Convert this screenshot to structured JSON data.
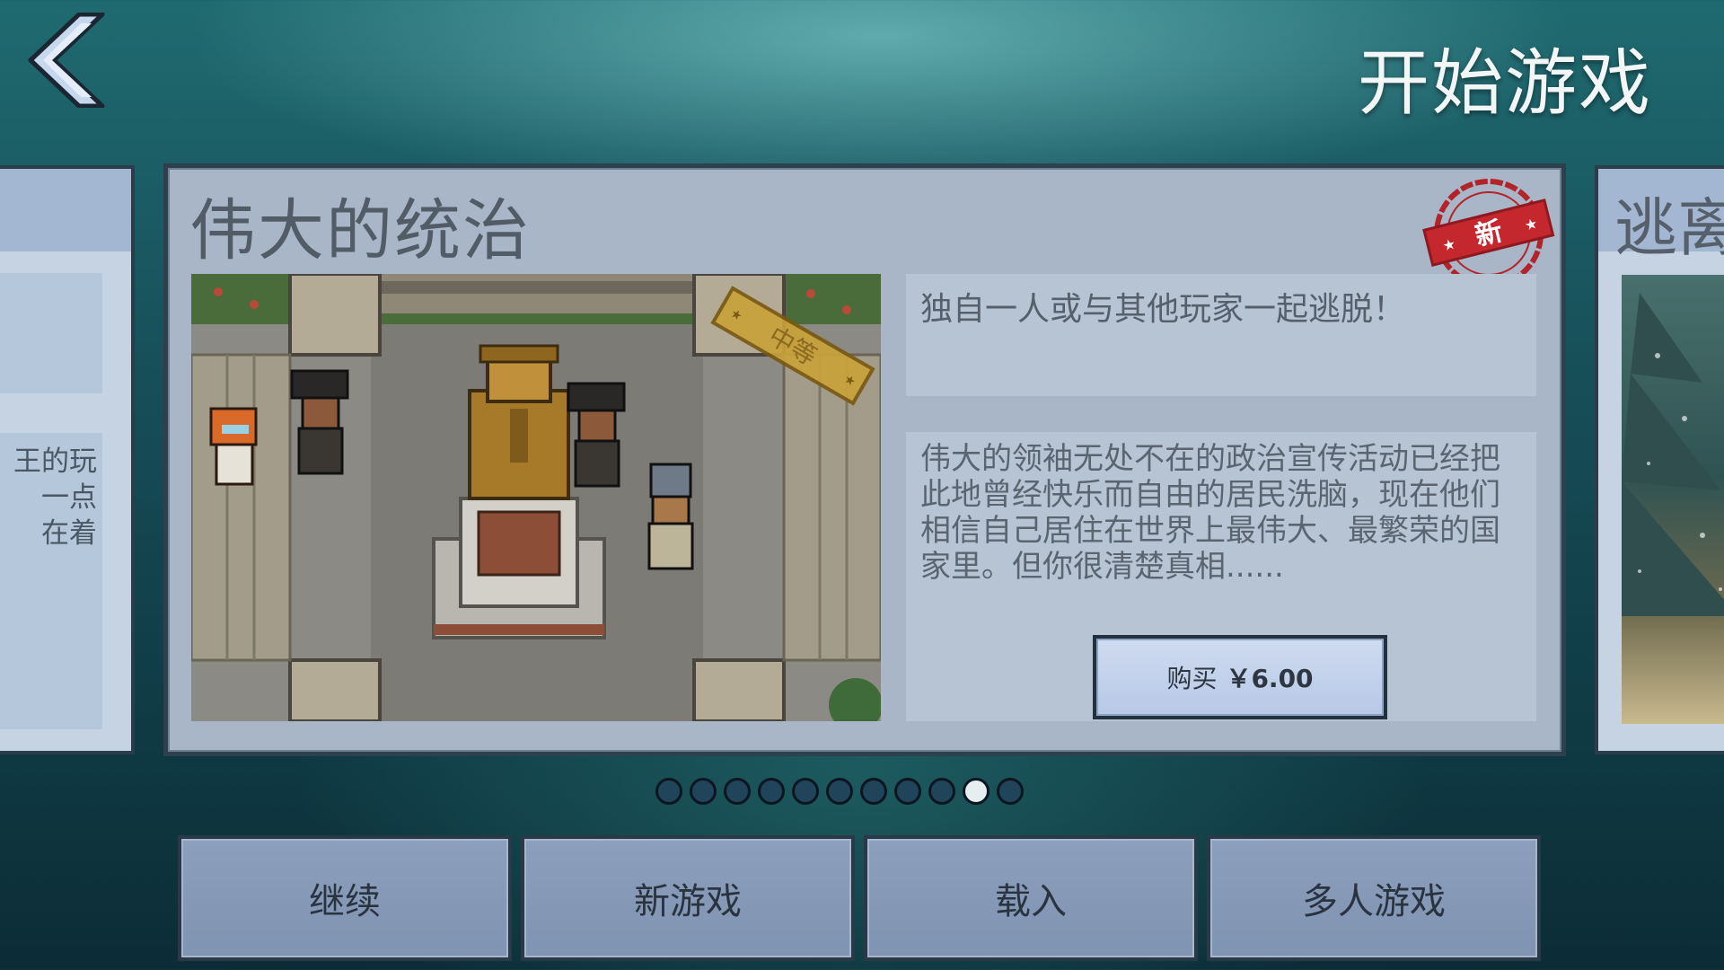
{
  "header": {
    "title": "开始游戏",
    "back_icon": "back-chevron-icon"
  },
  "left_card": {
    "text_lines": [
      "王的玩",
      "一点",
      "在着"
    ]
  },
  "main_card": {
    "title": "伟大的统治",
    "stamp_label": "新",
    "difficulty_badge": "中等",
    "tagline": "独自一人或与其他玩家一起逃脱！",
    "description": "伟大的领袖无处不在的政治宣传活动已经把此地曾经快乐而自由的居民洗脑，现在他们相信自己居住在世界上最伟大、最繁荣的国家里。但你很清楚真相......",
    "buy": {
      "label": "购买",
      "price": "￥6.00"
    }
  },
  "right_card": {
    "title": "逃离"
  },
  "pager": {
    "total": 11,
    "active_index": 9
  },
  "menu": {
    "continue_label": "继续",
    "new_game_label": "新游戏",
    "load_label": "载入",
    "multiplayer_label": "多人游戏"
  },
  "colors": {
    "background_top": "#1f6a70",
    "background_bottom": "#0c2c36",
    "card_bg": "#a9b6c7",
    "button_bg": "#8ca0bd",
    "stamp_red": "#b3232a",
    "badge_gold": "#c9a23a"
  }
}
